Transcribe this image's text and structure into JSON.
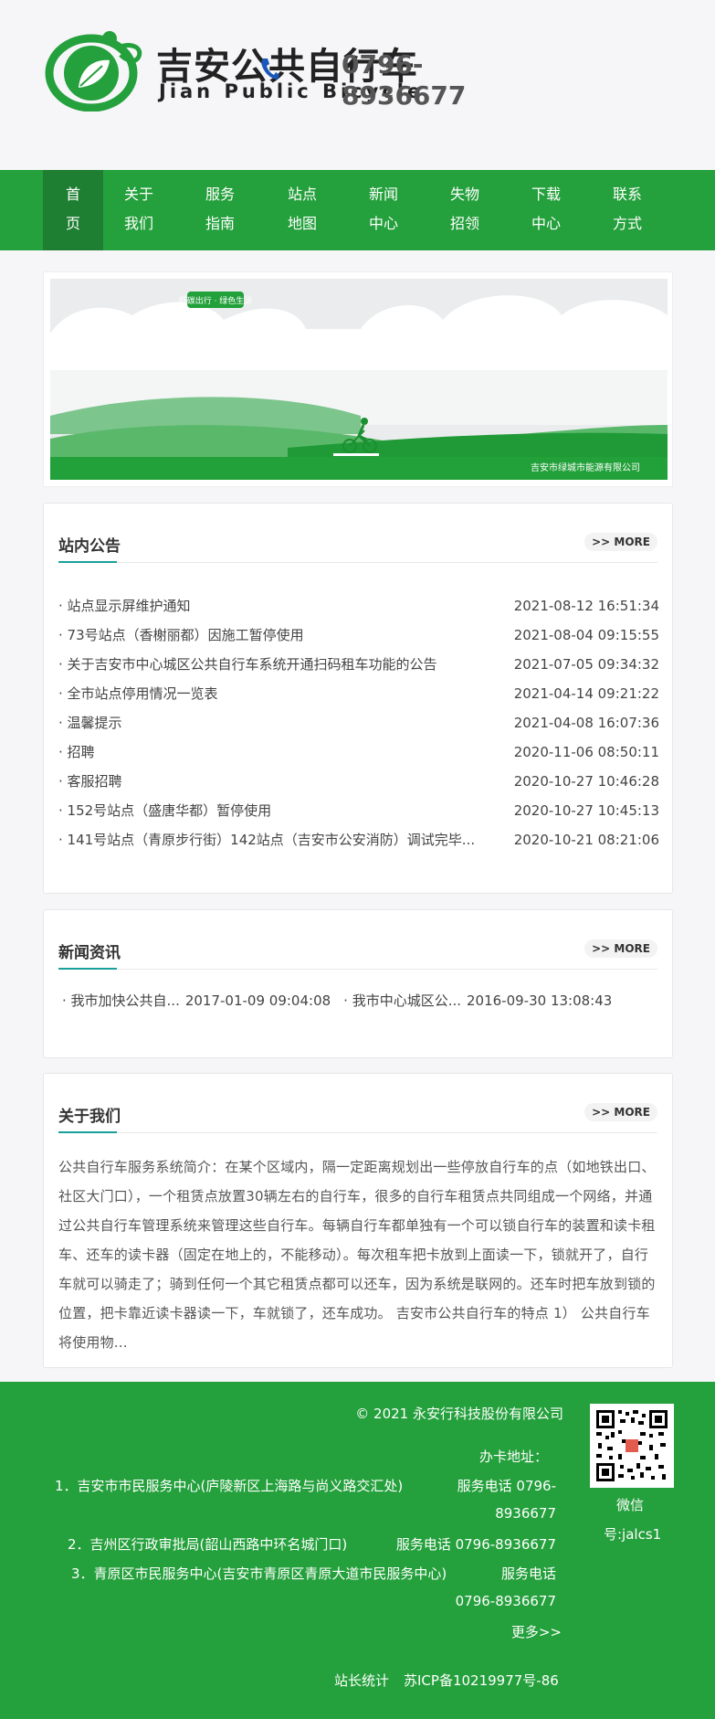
{
  "header": {
    "logo_cn": "吉安公共自行车",
    "logo_en": "Jian Public Bicycle",
    "phone_line1": "0796-",
    "phone_line2": "8936677",
    "brand_color": "#24a03c"
  },
  "nav": {
    "items": [
      {
        "line1": "首",
        "line2": "页"
      },
      {
        "line1": "关于",
        "line2": "我们"
      },
      {
        "line1": "服务",
        "line2": "指南"
      },
      {
        "line1": "站点",
        "line2": "地图"
      },
      {
        "line1": "新闻",
        "line2": "中心"
      },
      {
        "line1": "失物",
        "line2": "招领"
      },
      {
        "line1": "下载",
        "line2": "中心"
      },
      {
        "line1": "联系",
        "line2": "方式"
      }
    ]
  },
  "banner": {
    "tag": "低碳出行 · 绿色生活",
    "company": "吉安市绿城市能源有限公司"
  },
  "notices": {
    "title": "站内公告",
    "more": ">> MORE",
    "items": [
      {
        "title": "· 站点显示屏维护通知",
        "date": "2021-08-12 16:51:34"
      },
      {
        "title": "· 73号站点（香榭丽都）因施工暂停使用",
        "date": "2021-08-04 09:15:55"
      },
      {
        "title": "· 关于吉安市中心城区公共自行车系统开通扫码租车功能的公告",
        "date": "2021-07-05 09:34:32"
      },
      {
        "title": "· 全市站点停用情况一览表",
        "date": "2021-04-14 09:21:22"
      },
      {
        "title": "· 温馨提示",
        "date": "2021-04-08 16:07:36"
      },
      {
        "title": "· 招聘",
        "date": "2020-11-06 08:50:11"
      },
      {
        "title": "· 客服招聘",
        "date": "2020-10-27 10:46:28"
      },
      {
        "title": "· 152号站点（盛唐华都）暂停使用",
        "date": "2020-10-27 10:45:13"
      },
      {
        "title": "· 141号站点（青原步行街）142站点（吉安市公安消防）调试完毕...",
        "date": "2020-10-21 08:21:06"
      }
    ]
  },
  "news": {
    "title": "新闻资讯",
    "more": ">> MORE",
    "items": [
      {
        "title": "·  我市加快公共自...",
        "date": "2017-01-09 09:04:08"
      },
      {
        "title": "·  我市中心城区公...",
        "date": "2016-09-30 13:08:43"
      }
    ]
  },
  "about": {
    "title": "关于我们",
    "more": ">> MORE",
    "text": "公共自行车服务系统简介：在某个区域内，隔一定距离规划出一些停放自行车的点（如地铁出口、社区大门口），一个租赁点放置30辆左右的自行车，很多的自行车租赁点共同组成一个网络，并通过公共自行车管理系统来管理这些自行车。每辆自行车都单独有一个可以锁自行车的装置和读卡租车、还车的读卡器（固定在地上的，不能移动）。每次租车把卡放到上面读一下，锁就开了，自行车就可以骑走了；骑到任何一个其它租赁点都可以还车，因为系统是联网的。还车时把车放到锁的位置，把卡靠近读卡器读一下，车就锁了，还车成功。 吉安市公共自行车的特点 1） 公共自行车将使用物..."
  },
  "footer": {
    "copyright": "© 2021 永安行科技股份有限公司",
    "card_title": "办卡地址：",
    "addr1": "1．吉安市市民服务中心(庐陵新区上海路与尚义路交汇处)",
    "addr1_phone_a": "服务电话 0796-",
    "addr1_phone_b": "8936677",
    "addr2": "2．吉州区行政审批局(韶山西路中环名城门口)",
    "addr2_phone": "服务电话 0796-8936677",
    "addr3": "3．青原区市民服务中心(吉安市青原区青原大道市民服务中心)",
    "addr3_phone_a": "服务电话",
    "addr3_phone_b": "0796-8936677",
    "more": "更多>>",
    "stats": "站长统计",
    "icp": "苏ICP备10219977号-86",
    "wechat_a": "微信",
    "wechat_b": "号:jalcs1"
  }
}
